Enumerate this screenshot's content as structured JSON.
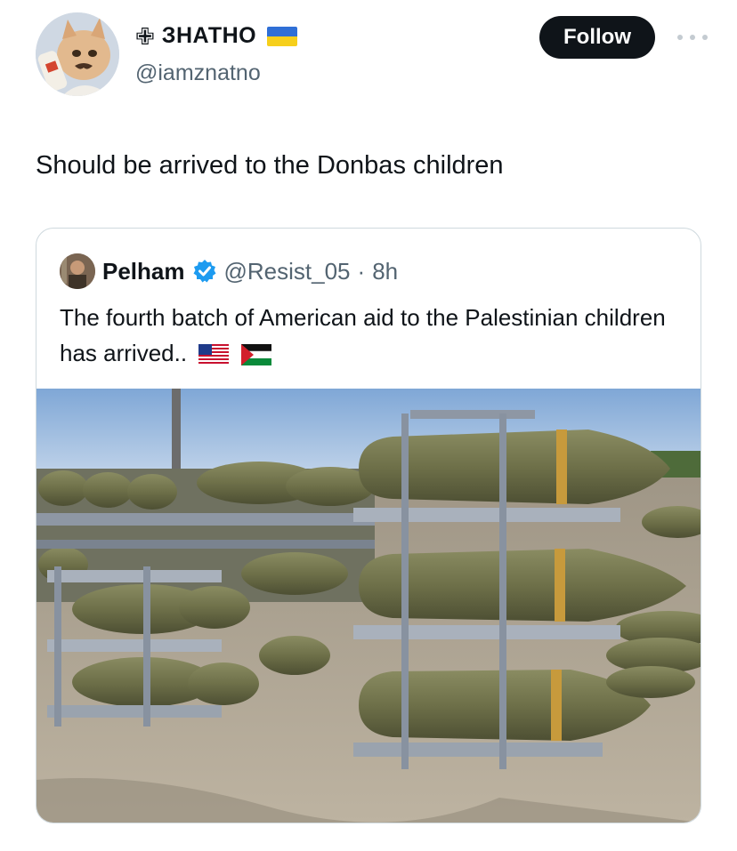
{
  "post": {
    "author": {
      "cross_symbol": "✙",
      "display_name": "ЗНАТНО",
      "flag_icon": "ukraine-flag-icon",
      "handle": "@iamznatno"
    },
    "follow_label": "Follow",
    "more_icon": "more-dots-icon",
    "text": "Should be arrived to the Donbas children"
  },
  "quote": {
    "author": {
      "display_name": "Pelham",
      "verified_icon": "verified-badge-icon",
      "handle": "@Resist_05",
      "separator": "·",
      "time": "8h"
    },
    "text": "The fourth batch of American aid to the Palestinian children has arrived..",
    "flags": [
      "us-flag-icon",
      "palestine-flag-icon"
    ],
    "image": "photo of stacked aerial bombs on metal pallets outdoors"
  },
  "colors": {
    "follow_bg": "#0f1419",
    "follow_text": "#ffffff",
    "secondary_text": "#536471",
    "verified_blue": "#1d9bf0",
    "border": "#cfd9de"
  }
}
